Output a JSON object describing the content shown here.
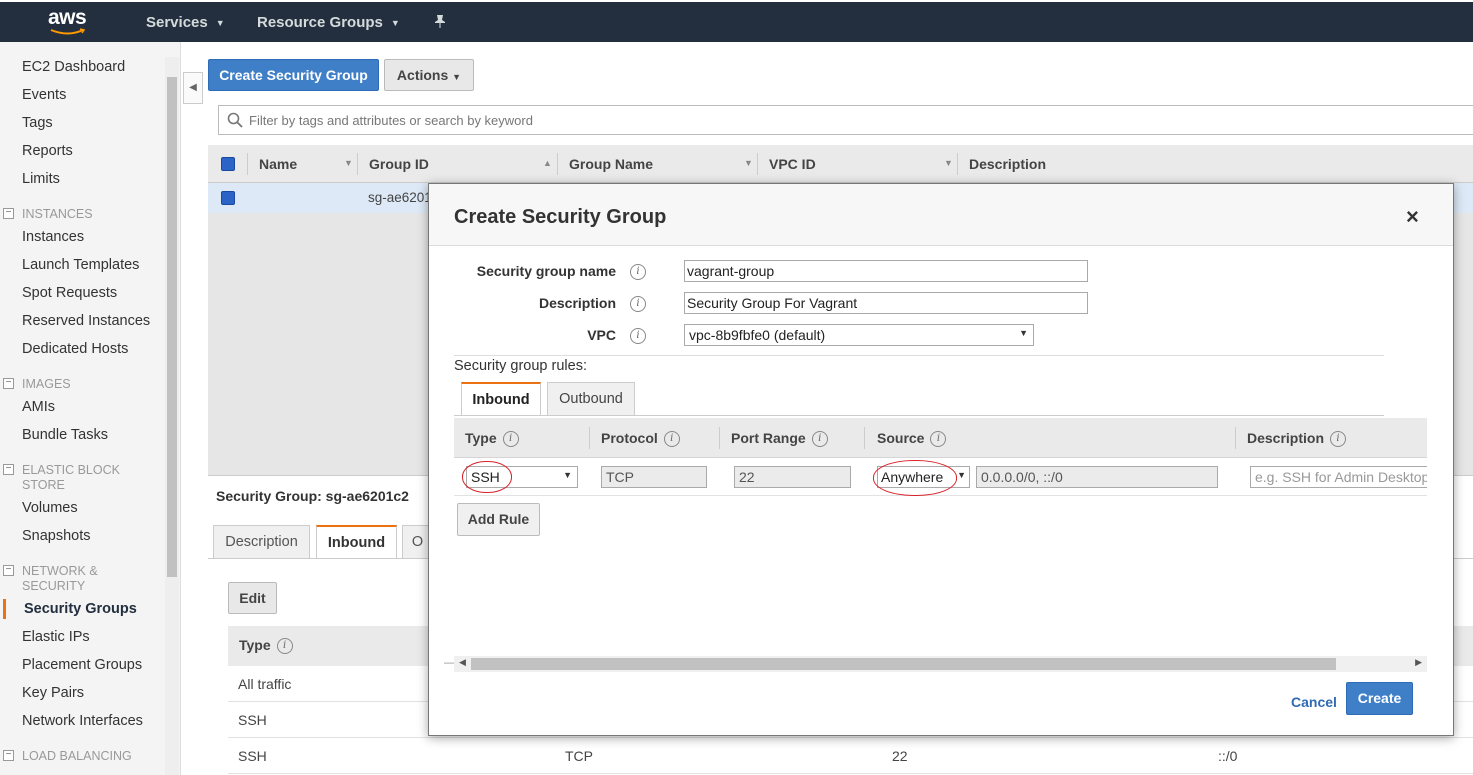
{
  "topnav": {
    "logo_text": "aws",
    "services": "Services",
    "resource_groups": "Resource Groups"
  },
  "sidebar": {
    "items_top": [
      "EC2 Dashboard",
      "Events",
      "Tags",
      "Reports",
      "Limits"
    ],
    "sections": [
      {
        "header": "INSTANCES",
        "items": [
          "Instances",
          "Launch Templates",
          "Spot Requests",
          "Reserved Instances",
          "Dedicated Hosts"
        ]
      },
      {
        "header": "IMAGES",
        "items": [
          "AMIs",
          "Bundle Tasks"
        ]
      },
      {
        "header": "ELASTIC BLOCK STORE",
        "items": [
          "Volumes",
          "Snapshots"
        ]
      },
      {
        "header": "NETWORK & SECURITY",
        "items": [
          "Security Groups",
          "Elastic IPs",
          "Placement Groups",
          "Key Pairs",
          "Network Interfaces"
        ]
      },
      {
        "header": "LOAD BALANCING",
        "items": []
      }
    ],
    "active_item": "Security Groups"
  },
  "toolbar": {
    "create_button": "Create Security Group",
    "actions_button": "Actions"
  },
  "filter": {
    "placeholder": "Filter by tags and attributes or search by keyword"
  },
  "grid": {
    "columns": [
      "Name",
      "Group ID",
      "Group Name",
      "VPC ID",
      "Description"
    ],
    "rows": [
      {
        "name": "",
        "group_id": "sg-ae6201"
      }
    ]
  },
  "details": {
    "title": "Security Group: sg-ae6201c2",
    "tabs": [
      "Description",
      "Inbound",
      "O"
    ],
    "active_tab": "Inbound",
    "edit_button": "Edit",
    "table_header": "Type",
    "rows": [
      {
        "type": "All traffic",
        "protocol": "",
        "port": "",
        "source": ""
      },
      {
        "type": "SSH",
        "protocol": "",
        "port": "",
        "source": ""
      },
      {
        "type": "SSH",
        "protocol": "TCP",
        "port": "22",
        "source": "::/0"
      }
    ]
  },
  "dialog": {
    "title": "Create Security Group",
    "close": "×",
    "fields": {
      "name_label": "Security group name",
      "name_value": "vagrant-group",
      "description_label": "Description",
      "description_value": "Security Group For Vagrant",
      "vpc_label": "VPC",
      "vpc_value": "vpc-8b9fbfe0 (default)"
    },
    "rules_label": "Security group rules:",
    "rule_tabs": [
      "Inbound",
      "Outbound"
    ],
    "active_rule_tab": "Inbound",
    "rule_columns": [
      "Type",
      "Protocol",
      "Port Range",
      "Source",
      "Description"
    ],
    "rule": {
      "type": "SSH",
      "protocol": "TCP",
      "port_range": "22",
      "source_type": "Anywhere",
      "source_value": "0.0.0.0/0, ::/0",
      "description_placeholder": "e.g. SSH for Admin Desktop"
    },
    "add_rule_button": "Add Rule",
    "cancel_button": "Cancel",
    "create_button": "Create"
  },
  "colors": {
    "nav_bg": "#232f3e",
    "primary_button": "#3f7fc8",
    "active_accent": "#ec7211",
    "annotation_red": "#d9232b"
  }
}
